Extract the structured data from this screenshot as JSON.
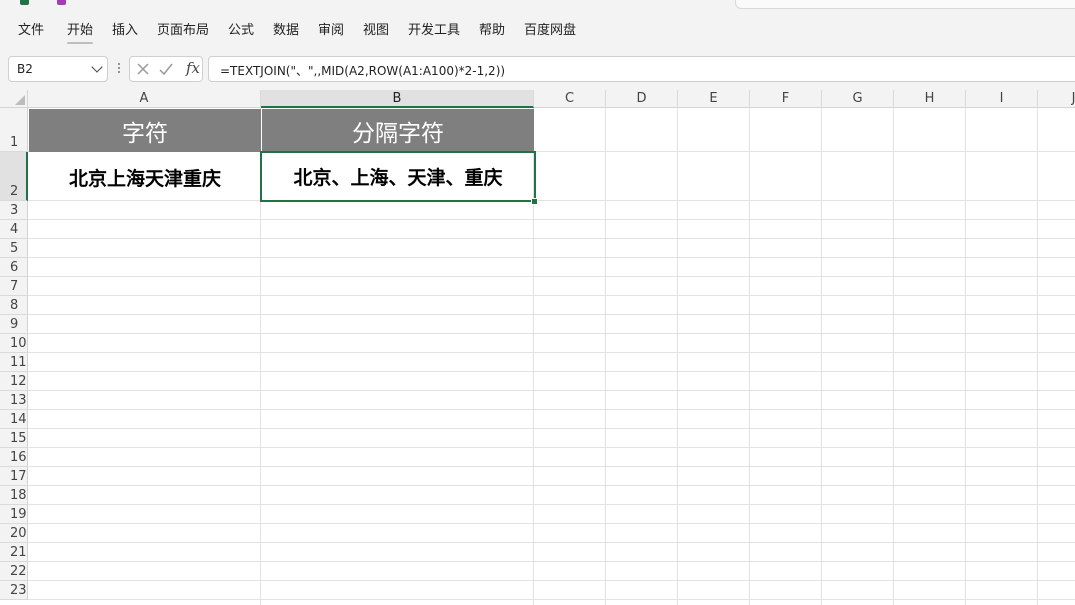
{
  "menu": {
    "items": [
      "文件",
      "开始",
      "插入",
      "页面布局",
      "公式",
      "数据",
      "审阅",
      "视图",
      "开发工具",
      "帮助",
      "百度网盘"
    ],
    "active_index": 1
  },
  "formula_bar": {
    "name_box": "B2",
    "cancel_icon": "x-icon",
    "enter_icon": "check-icon",
    "fx_label": "fx",
    "formula": "=TEXTJOIN(\"、\",,MID(A2,ROW(A1:A100)*2-1,2))"
  },
  "sheet": {
    "columns": [
      "A",
      "B",
      "C",
      "D",
      "E",
      "F",
      "G",
      "H",
      "I",
      "J"
    ],
    "rows": [
      "1",
      "2",
      "3",
      "4",
      "5",
      "6",
      "7",
      "8",
      "9",
      "10",
      "11",
      "12",
      "13",
      "14",
      "15",
      "16",
      "17",
      "18",
      "19",
      "20",
      "21",
      "22",
      "23"
    ],
    "selected_cell": "B2",
    "cells": {
      "A1": "字符",
      "B1": "分隔字符",
      "A2": "北京上海天津重庆",
      "B2": "北京、上海、天津、重庆"
    },
    "header_fill": "#7f7f7f",
    "accent": "#217346"
  }
}
